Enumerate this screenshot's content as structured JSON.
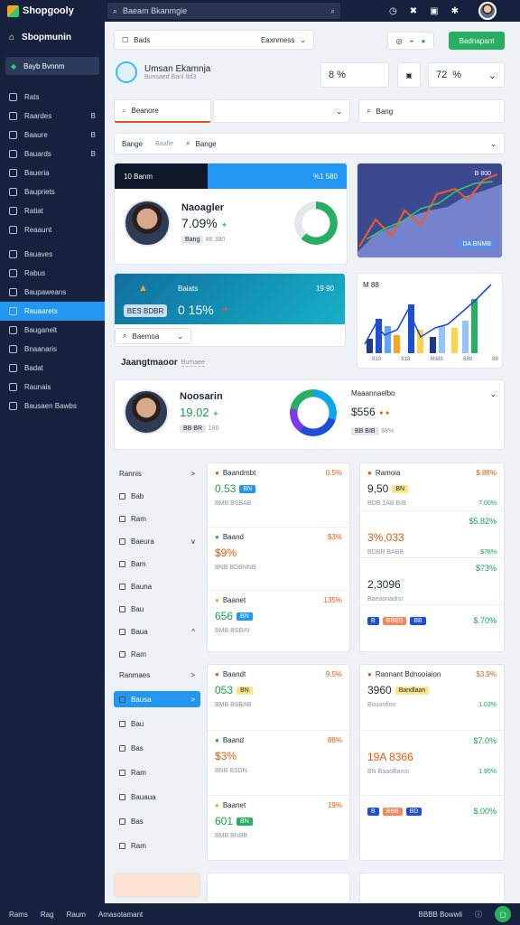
{
  "app": {
    "name": "Shopgooly",
    "search_text": "Baeam Bkanmgie"
  },
  "header": {
    "home": "Sbopmunin",
    "filter": "Bads",
    "filter_right": "Eaxnmess",
    "action": "Badnapant"
  },
  "sidebar": {
    "top": "Bayb Bvnnm",
    "items": [
      {
        "label": "Rats",
        "right": ""
      },
      {
        "label": "Raardes",
        "right": "B"
      },
      {
        "label": "Baaure",
        "right": "B"
      },
      {
        "label": "Bauards",
        "right": "B"
      },
      {
        "label": "Baueria",
        "right": ""
      },
      {
        "label": "Baupriets",
        "right": ""
      },
      {
        "label": "Ratiat",
        "right": ""
      },
      {
        "label": "Reaaunt",
        "right": ""
      },
      {
        "label": "Bauaves",
        "right": ""
      },
      {
        "label": "Rabus",
        "right": ""
      },
      {
        "label": "Baupaweans",
        "right": ""
      },
      {
        "label": "Rauaarets",
        "right": ""
      },
      {
        "label": "Bauganelt",
        "right": ""
      },
      {
        "label": "Bnaanaris",
        "right": ""
      },
      {
        "label": "Badat",
        "right": ""
      },
      {
        "label": "Raunais",
        "right": ""
      },
      {
        "label": "Bausaen Bawbs",
        "right": ""
      }
    ]
  },
  "profile": {
    "name": "Umsan Ekamnja",
    "sub": "Bunsaed Banl 8d3",
    "s1": "8 %",
    "s2": "72",
    "s3": "%"
  },
  "filters": {
    "a": "Beanore",
    "b": "Bang",
    "c1": "Bange",
    "c2": "Baafle",
    "c3": "Bange"
  },
  "panel1": {
    "header": "10 Banm",
    "hr": "%1 580",
    "name": "Naoagler",
    "value": "7.09%",
    "tag": "Bang",
    "tag2": "88 380"
  },
  "chart1": {
    "label": "B 800",
    "tag": "DA BNMB"
  },
  "panel2": {
    "header": "Baiats",
    "hr": "19 90",
    "value": "0 15%",
    "btn": "BES BDBR",
    "sel": "Baemoa"
  },
  "chart2": {
    "title": "M 88",
    "ticks": [
      "810",
      "818",
      "8N88",
      "888",
      "88"
    ]
  },
  "panel3": {
    "tabs": [
      "Jaangtmaoor",
      "Bumaee"
    ],
    "name": "Noosarin",
    "value": "19.02",
    "tag": "BB BR",
    "tag2": "186"
  },
  "panel3b": {
    "label": "Maaannaelbo",
    "value": "$556",
    "tag": "BB BIB",
    "tag2": "88%"
  },
  "lists": {
    "nav1": [
      {
        "label": "Rannis",
        "r": ">"
      },
      {
        "label": "Bab",
        "r": ""
      },
      {
        "label": "Ram",
        "r": ""
      },
      {
        "label": "Baeura",
        "r": "v"
      },
      {
        "label": "Bam",
        "r": ""
      },
      {
        "label": "Bauna",
        "r": ""
      },
      {
        "label": "Bau",
        "r": ""
      },
      {
        "label": "Baua",
        "r": "^"
      },
      {
        "label": "Ram",
        "r": ""
      }
    ],
    "nav2": [
      {
        "label": "Ranmaes",
        "r": ">"
      },
      {
        "label": "Bausa",
        "r": ">"
      },
      {
        "label": "Bau",
        "r": ""
      },
      {
        "label": "Bas",
        "r": ""
      },
      {
        "label": "Ram",
        "r": ""
      },
      {
        "label": "Bauaua",
        "r": ""
      },
      {
        "label": "Bas",
        "r": ""
      },
      {
        "label": "Ram",
        "r": ""
      }
    ],
    "cardA": [
      {
        "title": "Baandmbt",
        "val": "0.53",
        "tagA": "BN",
        "right": "0.5%",
        "sub": "BMB BSBAB"
      },
      {
        "title": "Baand",
        "val": "$9%",
        "right": "$3%",
        "sub": "BNB BDBNNB"
      },
      {
        "title": "Baanet",
        "val": "656",
        "tagA": "BN",
        "right": "135%",
        "sub": "BMB BSBIN"
      }
    ],
    "cardB": [
      {
        "title": "Ramoia",
        "val": "9,50",
        "tag": "BN",
        "right": "$.88%",
        "sub": "BDB 1AB BIB",
        "r2": "7.00%"
      },
      {
        "val": "3%,033",
        "right": "$5.82%",
        "sub": "BDBR BABB",
        "r2": "$78%"
      },
      {
        "val": "2,3096",
        "right": "$73%",
        "sub": "Baeaonadnn"
      },
      {
        "val": "",
        "right": "$.70%",
        "tags": [
          "B",
          "BBBS",
          "BB"
        ]
      }
    ],
    "cardC": [
      {
        "title": "Baandt",
        "val": "053",
        "tag": "BN",
        "right": "9.5%",
        "sub": "BMB BSBAB"
      },
      {
        "title": "Baand",
        "val": "$3%",
        "right": "88%",
        "sub": "BNB BSDN"
      },
      {
        "title": "Baanet",
        "val": "601",
        "tag": "BN",
        "right": "19%",
        "sub": "BMB BNBB"
      }
    ],
    "cardD": [
      {
        "title": "Raonant Bdnooiaion",
        "val": "3960",
        "tag": "Bandlaan",
        "right": "$3.9%",
        "sub": "Bouanfion",
        "r2": "1.03%"
      },
      {
        "val": "19A 8366",
        "right": "$7.0%",
        "sub": "BN BaaoBanoi",
        "r2": "1.95%"
      },
      {
        "val": "",
        "right": "$.00%",
        "tags": [
          "B",
          "BBB",
          "BD"
        ]
      }
    ]
  },
  "bottom": {
    "left": [
      "Rams",
      "Rag",
      "Raum",
      "Amasotamant"
    ],
    "right": "BBBB Bowwli"
  },
  "colors": {
    "accent": "#2196f3",
    "dark": "#16213d",
    "green": "#27ae60",
    "orange": "#e8590c"
  }
}
